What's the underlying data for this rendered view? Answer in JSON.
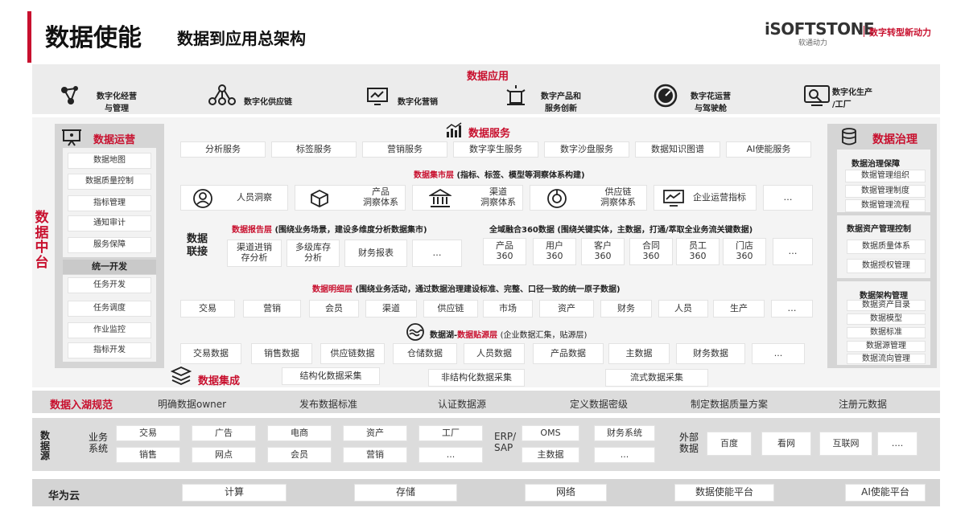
{
  "header": {
    "title": "数据使能",
    "subtitle": "数据到应用总架构",
    "brand_logo": "iSOFTSTONE",
    "brand_sub": "软通动力",
    "brand_slogan": "数字转型新动力"
  },
  "app_layer": {
    "title": "数据应用",
    "items": [
      "数字化经营\n与管理",
      "数字化供应链",
      "数字化营销",
      "数字产品和\n服务创新",
      "数字花运营\n与驾驶舱",
      "数字化生产\n/工厂"
    ]
  },
  "data_platform_label": "数据中台",
  "data_ops": {
    "title": "数据运营",
    "items": [
      "数据地图",
      "数据质量控制",
      "指标管理",
      "通知审计",
      "服务保障"
    ],
    "dev_title": "统一开发",
    "dev_items": [
      "任务开发",
      "任务调度",
      "作业监控",
      "指标开发"
    ]
  },
  "data_service": {
    "title": "数据服务",
    "items": [
      "分析服务",
      "标签服务",
      "营销服务",
      "数字孪生服务",
      "数字沙盘服务",
      "数据知识图谱",
      "AI使能服务"
    ]
  },
  "mart": {
    "title": "数据集市层",
    "desc": "(指标、标签、模型等洞察体系构建)",
    "items": [
      "人员洞察",
      "产品\n洞察体系",
      "渠道\n洞察体系",
      "供应链\n洞察体系",
      "企业运营指标",
      "…"
    ]
  },
  "report": {
    "title": "数据报告层",
    "desc": "(围绕业务场景，建设多维度分析数据集市)",
    "items": [
      "渠道进销\n存分析",
      "多级库存\n分析",
      "财务报表",
      "…"
    ]
  },
  "link_label": "数据\n联接",
  "fusion": {
    "title": "全域融合360数据",
    "desc": "(围绕关键实体，主数据，打通/萃取全业务流关键数据)",
    "items": [
      "产品\n360",
      "用户\n360",
      "客户\n360",
      "合同\n360",
      "员工\n360",
      "门店\n360",
      "…"
    ]
  },
  "detail": {
    "title": "数据明细层",
    "desc": "(围绕业务活动，通过数据治理建设标准、完整、口径一致的统一原子数据)",
    "items": [
      "交易",
      "营销",
      "会员",
      "渠道",
      "供应链",
      "市场",
      "资产",
      "财务",
      "人员",
      "生产",
      "…"
    ]
  },
  "lake": {
    "title_a": "数据湖-",
    "title_b": "数据贴源层",
    "desc": "(企业数据汇集，贴源层)",
    "items": [
      "交易数据",
      "销售数据",
      "供应链数据",
      "仓储数据",
      "人员数据",
      "产品数据",
      "主数据",
      "财务数据",
      "..."
    ]
  },
  "integration": {
    "title": "数据集成",
    "items": [
      "结构化数据采集",
      "非结构化数据采集",
      "流式数据采集"
    ]
  },
  "governance": {
    "title": "数据治理",
    "g1_title": "数据治理保障",
    "g1_items": [
      "数据管理组织",
      "数据管理制度",
      "数据管理流程"
    ],
    "g2_title": "数据资产管理控制",
    "g2_items": [
      "数据质量体系",
      "数据授权管理"
    ],
    "g3_title": "数据架构管理",
    "g3_items": [
      "数据资产目录",
      "数据模型",
      "数据标准",
      "数据源管理",
      "数据流向管理"
    ]
  },
  "lake_spec": {
    "title": "数据入湖规范",
    "items": [
      "明确数据owner",
      "发布数据标准",
      "认证数据源",
      "定义数据密级",
      "制定数据质量方案",
      "注册元数据"
    ]
  },
  "sources": {
    "title": "数据源",
    "biz_label": "业务\n系统",
    "biz_top": [
      "交易",
      "广告",
      "电商",
      "资产",
      "工厂"
    ],
    "biz_bottom": [
      "销售",
      "网点",
      "会员",
      "营销",
      "..."
    ],
    "erp_label": "ERP/\nSAP",
    "erp_top": [
      "OMS",
      "财务系统"
    ],
    "erp_bottom": [
      "主数据",
      "..."
    ],
    "ext_label": "外部\n数据",
    "ext_items": [
      "百度",
      "看网",
      "互联网",
      "…."
    ]
  },
  "cloud": {
    "title": "华为云",
    "items": [
      "计算",
      "存储",
      "网络",
      "数据使能平台",
      "AI使能平台"
    ]
  }
}
